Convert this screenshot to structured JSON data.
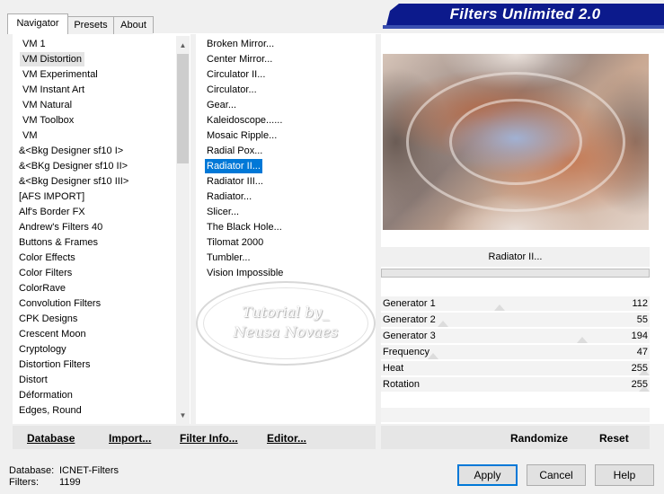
{
  "tabs": [
    {
      "label": "Navigator"
    },
    {
      "label": "Presets"
    },
    {
      "label": "About"
    }
  ],
  "banner": {
    "title": "Filters Unlimited 2.0",
    "color": "#0c1a8c"
  },
  "categories": {
    "items": [
      {
        "label": "VM 1"
      },
      {
        "label": "VM Distortion"
      },
      {
        "label": "VM Experimental"
      },
      {
        "label": "VM Instant Art"
      },
      {
        "label": "VM Natural"
      },
      {
        "label": "VM Toolbox"
      },
      {
        "label": "VM"
      },
      {
        "label": "&<Bkg Designer sf10 I>"
      },
      {
        "label": "&<BKg Designer sf10 II>"
      },
      {
        "label": "&<Bkg Designer sf10 III>"
      },
      {
        "label": "[AFS IMPORT]"
      },
      {
        "label": "Alf's Border FX"
      },
      {
        "label": "Andrew's Filters 40"
      },
      {
        "label": "Buttons & Frames"
      },
      {
        "label": "Color Effects"
      },
      {
        "label": "Color Filters"
      },
      {
        "label": "ColorRave"
      },
      {
        "label": "Convolution Filters"
      },
      {
        "label": "CPK Designs"
      },
      {
        "label": "Crescent Moon"
      },
      {
        "label": "Cryptology"
      },
      {
        "label": "Distortion Filters"
      },
      {
        "label": "Distort"
      },
      {
        "label": "Déformation"
      },
      {
        "label": "Edges, Round"
      }
    ],
    "selected": "VM Distortion"
  },
  "filters": {
    "items": [
      {
        "label": "Broken Mirror..."
      },
      {
        "label": "Center Mirror..."
      },
      {
        "label": "Circulator II..."
      },
      {
        "label": "Circulator..."
      },
      {
        "label": "Gear..."
      },
      {
        "label": "Kaleidoscope......"
      },
      {
        "label": "Mosaic Ripple..."
      },
      {
        "label": "Radial Pox..."
      },
      {
        "label": "Radiator II..."
      },
      {
        "label": "Radiator III..."
      },
      {
        "label": "Radiator..."
      },
      {
        "label": "Slicer..."
      },
      {
        "label": "The Black Hole..."
      },
      {
        "label": "Tilomat 2000"
      },
      {
        "label": "Tumbler..."
      },
      {
        "label": "Vision Impossible"
      }
    ],
    "selected": "Radiator II..."
  },
  "watermark": {
    "line1": "Tutorial by_",
    "line2": "Neusa Novaes"
  },
  "preview": {
    "filter_name": "Radiator II..."
  },
  "params": [
    {
      "label": "Generator 1",
      "value": "112",
      "level": 0.44
    },
    {
      "label": "Generator 2",
      "value": "55",
      "level": 0.22
    },
    {
      "label": "Generator 3",
      "value": "194",
      "level": 0.76
    },
    {
      "label": "Frequency",
      "value": "47",
      "level": 0.18
    },
    {
      "label": "Heat",
      "value": "255",
      "level": 1.0
    },
    {
      "label": "Rotation",
      "value": "255",
      "level": 1.0
    }
  ],
  "left_buttons": {
    "database": "Database",
    "import": "Import...",
    "filter_info": "Filter Info...",
    "editor": "Editor..."
  },
  "right_buttons": {
    "randomize": "Randomize",
    "reset": "Reset"
  },
  "footer": {
    "database_label": "Database:",
    "database_value": "ICNET-Filters",
    "filters_label": "Filters:",
    "filters_value": "1199"
  },
  "dialog_buttons": {
    "apply": "Apply",
    "cancel": "Cancel",
    "help": "Help"
  },
  "colors": {
    "selection": "#0078d7",
    "hover_selection": "#e4e4e4"
  }
}
